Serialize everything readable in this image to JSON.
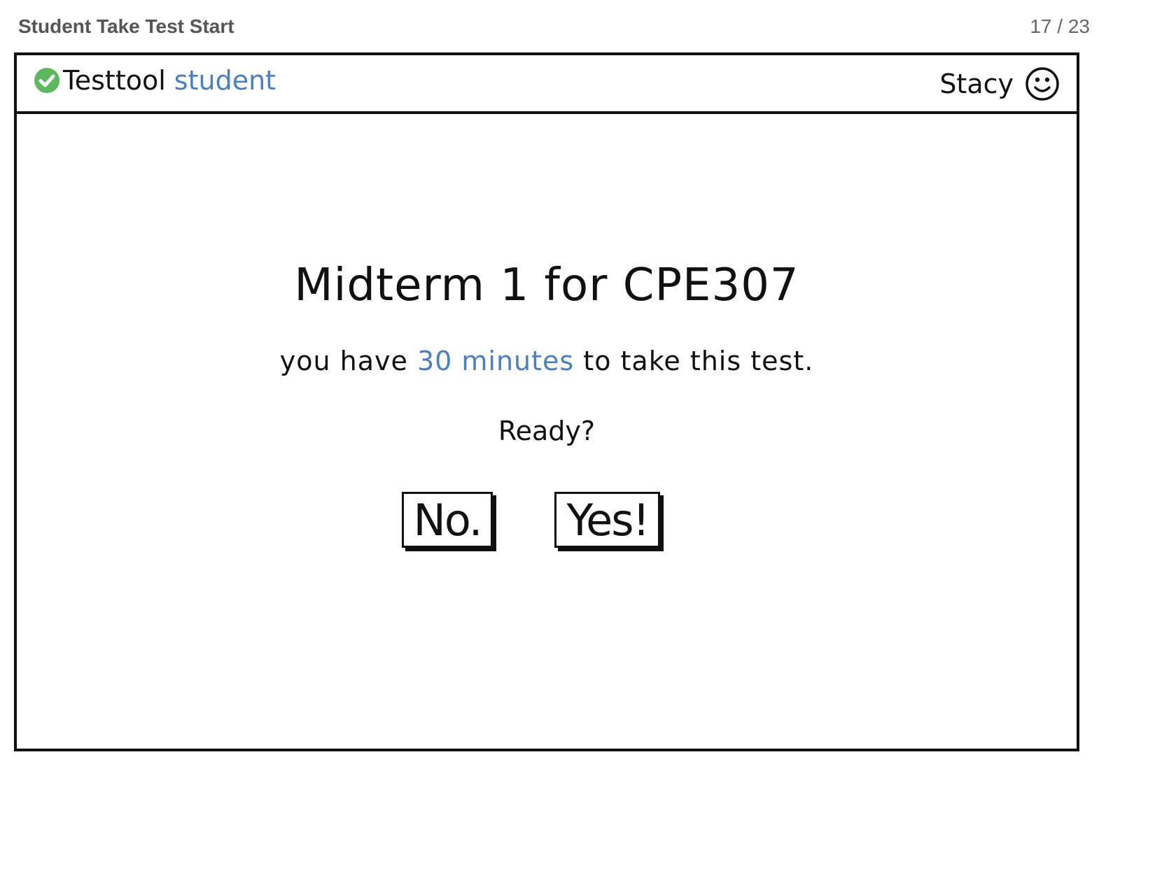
{
  "page": {
    "title": "Student Take Test Start",
    "counter": "17 / 23"
  },
  "header": {
    "brand_name": "Testtool",
    "brand_role": "student",
    "user_name": "Stacy",
    "brand_icon": "check-circle-icon",
    "user_icon": "smiley-icon"
  },
  "main": {
    "test_title": "Midterm 1 for CPE307",
    "time_prefix": "you have",
    "time_value": "30 minutes",
    "time_suffix": "to take this test.",
    "prompt": "Ready?",
    "no_label": "No.",
    "yes_label": "Yes!"
  },
  "colors": {
    "accent": "#4a7fc1",
    "check_green": "#5cb85c",
    "border": "#111111"
  }
}
